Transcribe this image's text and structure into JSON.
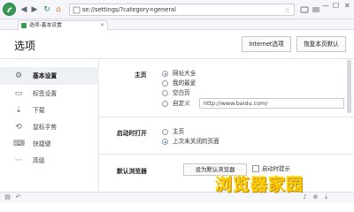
{
  "browser": {
    "address_url": "se://settings/?category=general",
    "tab_label": "选项-基本设置",
    "tab_close": "×",
    "nav_back": "◀",
    "nav_forward": "▶",
    "nav_reload": "↻",
    "win_min": "—",
    "win_max": "☐",
    "win_close": "✕"
  },
  "header": {
    "title": "选项",
    "internet_options": "Internet选项",
    "restore_defaults": "恢复本页默认"
  },
  "sidebar": {
    "items": [
      {
        "label": "基本设置",
        "icon": "gear-icon",
        "glyph": "⚙",
        "active": true
      },
      {
        "label": "标签设置",
        "icon": "tab-icon",
        "glyph": "▭",
        "active": false
      },
      {
        "label": "下载",
        "icon": "download-icon",
        "glyph": "⇣",
        "active": false
      },
      {
        "label": "鼠标手势",
        "icon": "mouse-gesture-icon",
        "glyph": "⟲",
        "active": false
      },
      {
        "label": "快捷键",
        "icon": "keyboard-icon",
        "glyph": "⌨",
        "active": false
      },
      {
        "label": "高级",
        "icon": "more-icon",
        "glyph": "···",
        "active": false
      }
    ]
  },
  "homepage": {
    "label": "主页",
    "options": [
      {
        "label": "网址大全",
        "selected": true
      },
      {
        "label": "我的最爱",
        "selected": false
      },
      {
        "label": "空白页",
        "selected": false
      },
      {
        "label": "自定义",
        "selected": false
      }
    ],
    "custom_url": "http://www.baidu.com/"
  },
  "startup": {
    "label": "启动时打开",
    "options": [
      {
        "label": "主页",
        "selected": false
      },
      {
        "label": "上次未关闭的页面",
        "selected": true
      }
    ]
  },
  "default_browser": {
    "label": "默认浏览器",
    "button": "设为默认浏览器",
    "checkbox_label": "启动时提示"
  },
  "watermark": "浏览器家园",
  "colors": {
    "accent": "#2b7de0",
    "brand": "#3a9b57",
    "watermark": "#ffcc00"
  }
}
